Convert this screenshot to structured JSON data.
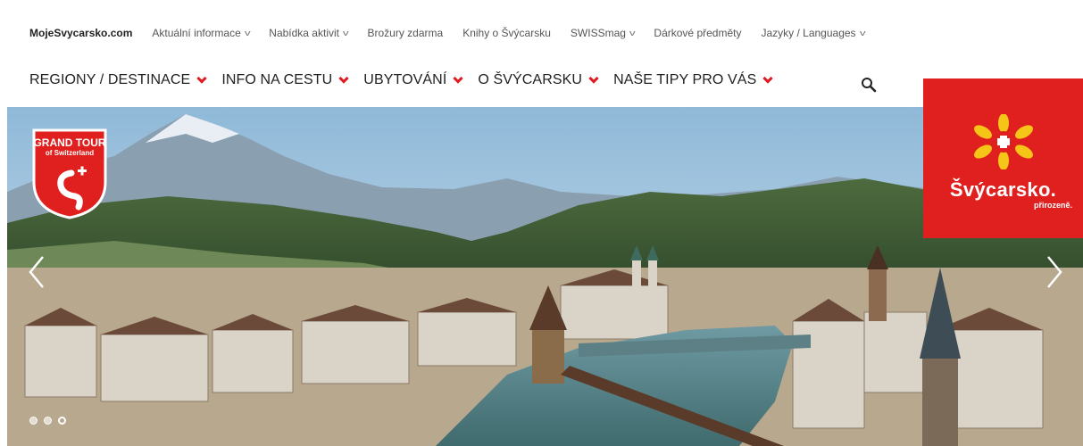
{
  "topnav": {
    "brand": "MojeSvycarsko.com",
    "items": [
      {
        "label": "Aktuální informace",
        "has_dropdown": true
      },
      {
        "label": "Nabídka aktivit",
        "has_dropdown": true
      },
      {
        "label": "Brožury zdarma",
        "has_dropdown": false
      },
      {
        "label": "Knihy o Švýcarsku",
        "has_dropdown": false
      },
      {
        "label": "SWISSmag",
        "has_dropdown": true
      },
      {
        "label": "Dárkové předměty",
        "has_dropdown": false
      },
      {
        "label": "Jazyky / Languages",
        "has_dropdown": true
      }
    ],
    "chevron_glyph": "v"
  },
  "mainnav": {
    "items": [
      {
        "label": "REGIONY / DESTINACE"
      },
      {
        "label": "INFO NA CESTU"
      },
      {
        "label": "UBYTOVÁNÍ"
      },
      {
        "label": "O ŠVÝCARSKU"
      },
      {
        "label": "NAŠE TIPY PRO VÁS"
      }
    ]
  },
  "search": {
    "icon": "search-icon"
  },
  "hero": {
    "badge_title": "GRAND TOUR",
    "badge_subtitle": "of Switzerland",
    "slides_count": 3,
    "active_slide": 3
  },
  "logo": {
    "name": "Švýcarsko.",
    "tagline": "přirozeně."
  },
  "colors": {
    "brand_red": "#e0201f",
    "accent_chevron": "#e01b22"
  }
}
